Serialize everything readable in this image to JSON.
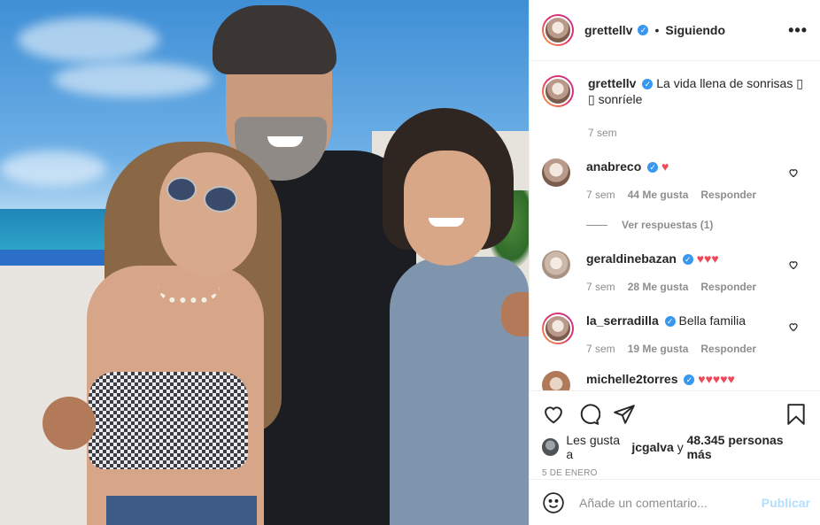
{
  "header": {
    "username": "grettellv",
    "separator": "•",
    "follow_status": "Siguiendo",
    "more_label": "•••"
  },
  "caption": {
    "username": "grettellv",
    "text": "La vida llena de sonrisas ▯ ▯ sonríele",
    "time": "7 sem"
  },
  "comments": [
    {
      "username": "anabreco",
      "text": "♥",
      "time": "7 sem",
      "likes": "44 Me gusta",
      "reply": "Responder",
      "view_replies": "Ver respuestas (1)"
    },
    {
      "username": "geraldinebazan",
      "text": "♥♥♥",
      "time": "7 sem",
      "likes": "28 Me gusta",
      "reply": "Responder"
    },
    {
      "username": "la_serradilla",
      "text": "Bella familia",
      "time": "7 sem",
      "likes": "19 Me gusta",
      "reply": "Responder"
    },
    {
      "username": "michelle2torres",
      "text": "♥♥♥♥♥"
    }
  ],
  "likes": {
    "prefix": "Les gusta a",
    "user": "jcgalva",
    "middle": "y",
    "count": "48.345 personas más"
  },
  "date": "5 DE ENERO",
  "add_comment": {
    "placeholder": "Añade un comentario...",
    "post_label": "Publicar"
  },
  "icons": [
    "verified-icon",
    "more-options-icon",
    "heart-icon",
    "comment-icon",
    "share-icon",
    "bookmark-icon",
    "emoji-icon"
  ],
  "colors": {
    "verified": "#3897f0",
    "heart_red": "#ed4956",
    "post_disabled": "#b2dffc",
    "muted": "#8e8e8e"
  }
}
